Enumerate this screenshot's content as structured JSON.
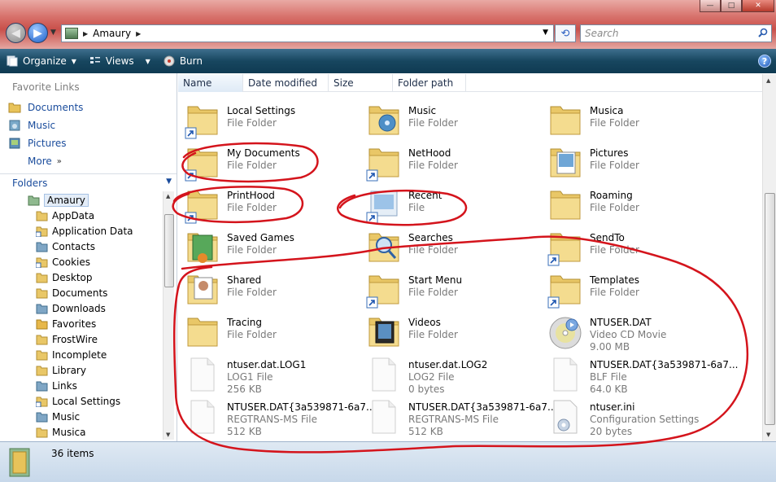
{
  "window": {
    "minimize_glyph": "—",
    "maximize_glyph": "□",
    "close_glyph": "✕"
  },
  "address": {
    "path": "Amaury",
    "search_placeholder": "Search"
  },
  "toolbar": {
    "organize": "Organize",
    "views": "Views",
    "burn": "Burn",
    "help": "?"
  },
  "nav": {
    "favorite_links_title": "Favorite Links",
    "favorites": [
      {
        "label": "Documents",
        "icon": "documents-folder-icon"
      },
      {
        "label": "Music",
        "icon": "music-folder-icon"
      },
      {
        "label": "Pictures",
        "icon": "pictures-folder-icon"
      },
      {
        "label": "More",
        "icon": "none"
      }
    ],
    "more_arrows": "»",
    "folders_title": "Folders",
    "tree": [
      {
        "label": "Amaury",
        "level": 1,
        "icon": "user-folder-icon",
        "selected": true
      },
      {
        "label": "AppData",
        "level": 2,
        "icon": "folder-icon"
      },
      {
        "label": "Application Data",
        "level": 2,
        "icon": "shortcut-folder-icon"
      },
      {
        "label": "Contacts",
        "level": 2,
        "icon": "contacts-folder-icon"
      },
      {
        "label": "Cookies",
        "level": 2,
        "icon": "shortcut-folder-icon"
      },
      {
        "label": "Desktop",
        "level": 2,
        "icon": "folder-icon"
      },
      {
        "label": "Documents",
        "level": 2,
        "icon": "folder-icon"
      },
      {
        "label": "Downloads",
        "level": 2,
        "icon": "downloads-folder-icon"
      },
      {
        "label": "Favorites",
        "level": 2,
        "icon": "favorites-folder-icon"
      },
      {
        "label": "FrostWire",
        "level": 2,
        "icon": "folder-icon"
      },
      {
        "label": "Incomplete",
        "level": 2,
        "icon": "folder-icon"
      },
      {
        "label": "Library",
        "level": 2,
        "icon": "folder-icon"
      },
      {
        "label": "Links",
        "level": 2,
        "icon": "links-folder-icon"
      },
      {
        "label": "Local Settings",
        "level": 2,
        "icon": "shortcut-folder-icon"
      },
      {
        "label": "Music",
        "level": 2,
        "icon": "music-folder-icon"
      },
      {
        "label": "Musica",
        "level": 2,
        "icon": "folder-icon"
      }
    ]
  },
  "columns": [
    "Name",
    "Date modified",
    "Size",
    "Folder path"
  ],
  "files": [
    {
      "name": "Local Settings",
      "type": "File Folder",
      "size": "",
      "icon": "shortcut-folder"
    },
    {
      "name": "Music",
      "type": "File Folder",
      "size": "",
      "icon": "music-folder"
    },
    {
      "name": "Musica",
      "type": "File Folder",
      "size": "",
      "icon": "folder"
    },
    {
      "name": "My Documents",
      "type": "File Folder",
      "size": "",
      "icon": "shortcut-folder"
    },
    {
      "name": "NetHood",
      "type": "File Folder",
      "size": "",
      "icon": "shortcut-folder"
    },
    {
      "name": "Pictures",
      "type": "File Folder",
      "size": "",
      "icon": "pictures-folder"
    },
    {
      "name": "PrintHood",
      "type": "File Folder",
      "size": "",
      "icon": "shortcut-folder"
    },
    {
      "name": "Recent",
      "type": "File",
      "size": "",
      "icon": "recent-shortcut"
    },
    {
      "name": "Roaming",
      "type": "File Folder",
      "size": "",
      "icon": "folder"
    },
    {
      "name": "Saved Games",
      "type": "File Folder",
      "size": "",
      "icon": "games-folder"
    },
    {
      "name": "Searches",
      "type": "File Folder",
      "size": "",
      "icon": "searches-folder"
    },
    {
      "name": "SendTo",
      "type": "File Folder",
      "size": "",
      "icon": "shortcut-folder"
    },
    {
      "name": "Shared",
      "type": "File Folder",
      "size": "",
      "icon": "shared-folder"
    },
    {
      "name": "Start Menu",
      "type": "File Folder",
      "size": "",
      "icon": "shortcut-folder"
    },
    {
      "name": "Templates",
      "type": "File Folder",
      "size": "",
      "icon": "shortcut-folder"
    },
    {
      "name": "Tracing",
      "type": "File Folder",
      "size": "",
      "icon": "folder"
    },
    {
      "name": "Videos",
      "type": "File Folder",
      "size": "",
      "icon": "videos-folder"
    },
    {
      "name": "NTUSER.DAT",
      "type": "Video CD Movie",
      "size": "9.00 MB",
      "icon": "vcd-file"
    },
    {
      "name": "ntuser.dat.LOG1",
      "type": "LOG1 File",
      "size": "256 KB",
      "icon": "blank-file"
    },
    {
      "name": "ntuser.dat.LOG2",
      "type": "LOG2 File",
      "size": "0 bytes",
      "icon": "blank-file"
    },
    {
      "name": "NTUSER.DAT{3a539871-6a7...",
      "type": "BLF File",
      "size": "64.0 KB",
      "icon": "blank-file"
    },
    {
      "name": "NTUSER.DAT{3a539871-6a7...",
      "type": "REGTRANS-MS File",
      "size": "512 KB",
      "icon": "blank-file"
    },
    {
      "name": "NTUSER.DAT{3a539871-6a7...",
      "type": "REGTRANS-MS File",
      "size": "512 KB",
      "icon": "blank-file"
    },
    {
      "name": "ntuser.ini",
      "type": "Configuration Settings",
      "size": "20 bytes",
      "icon": "config-file"
    }
  ],
  "status": {
    "count": "36 items"
  },
  "colors": {
    "annotation": "#d4141c",
    "link": "#1a4c9c",
    "toolbar": "#17465f"
  }
}
